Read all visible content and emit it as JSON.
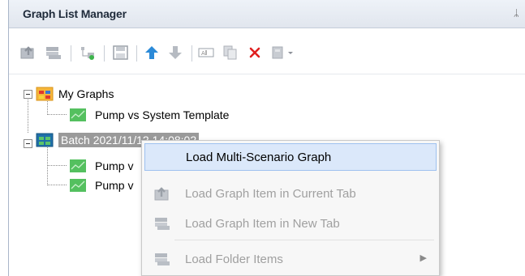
{
  "panel": {
    "title": "Graph List Manager",
    "pin_glyph": "ᛦ"
  },
  "toolbar": {
    "buttons": [
      {
        "name": "load-graph-current-tab-icon"
      },
      {
        "name": "load-graph-new-tab-icon"
      },
      {
        "name": "add-folder-icon"
      },
      {
        "name": "save-graph-icon"
      },
      {
        "name": "move-up-icon"
      },
      {
        "name": "move-down-icon"
      },
      {
        "name": "rename-icon"
      },
      {
        "name": "copy-icon"
      },
      {
        "name": "delete-icon"
      },
      {
        "name": "more-options-dropdown-icon"
      }
    ]
  },
  "tree": {
    "folders": [
      {
        "label": "My Graphs",
        "items": [
          {
            "label": "Pump vs System Template"
          }
        ]
      },
      {
        "label": "Batch 2021/11/12 14:08:02",
        "items": [
          {
            "label": "Pump v"
          },
          {
            "label": "Pump v"
          }
        ]
      }
    ]
  },
  "context_menu": {
    "items": [
      {
        "label": "Load Multi-Scenario Graph",
        "state": "highlighted"
      },
      {
        "label": "Load Graph Item in Current Tab",
        "state": "disabled"
      },
      {
        "label": "Load Graph Item in New Tab",
        "state": "disabled"
      },
      {
        "label": "Load Folder Items",
        "state": "disabled",
        "submenu": true
      }
    ]
  },
  "colors": {
    "accent_blue": "#2b8ad8",
    "delete_red": "#e02020",
    "graph_green": "#3cb44b",
    "selection_gray": "#9a9a9a",
    "menu_highlight": "#dbe8fa"
  }
}
